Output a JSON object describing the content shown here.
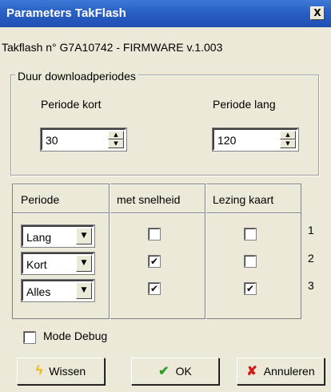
{
  "window": {
    "title": "Parameters TakFlash",
    "close_label": "X"
  },
  "info": "Takflash n° G7A10742   - FIRMWARE v.1.003",
  "download_group": {
    "label": "Duur downloadperiodes",
    "kort": {
      "label": "Periode kort",
      "value": "30"
    },
    "lang": {
      "label": "Periode lang",
      "value": "120"
    }
  },
  "table": {
    "headers": [
      "Periode",
      "met snelheid",
      "Lezing kaart"
    ],
    "rows": [
      {
        "num": "1",
        "periode": "Lang",
        "snelheid": false,
        "kaart": false
      },
      {
        "num": "2",
        "periode": "Kort",
        "snelheid": true,
        "kaart": false
      },
      {
        "num": "3",
        "periode": "Alles",
        "snelheid": true,
        "kaart": true
      }
    ]
  },
  "debug": {
    "label": "Mode Debug",
    "checked": false
  },
  "buttons": {
    "wissen": {
      "label": "Wissen",
      "icon": "lightning-icon"
    },
    "ok": {
      "label": "OK",
      "icon": "checkmark-icon"
    },
    "annuleren": {
      "label": "Annuleren",
      "icon": "cross-icon"
    }
  },
  "check_mark": "✔",
  "colors": {
    "titlebar": "#2a5fc4",
    "ok_icon": "#2d9e2d",
    "cancel_icon": "#d11a1a",
    "wissen_icon": "#e6b800"
  }
}
